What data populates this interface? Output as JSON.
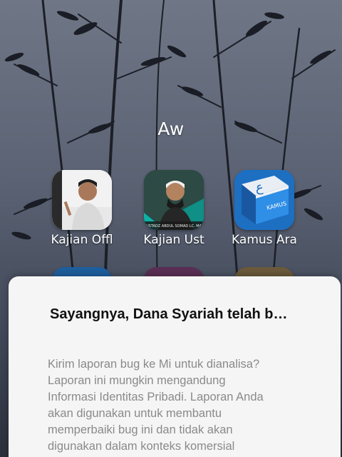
{
  "folder": {
    "title": "Aw",
    "apps": [
      {
        "label": "Kajian Offl",
        "icon": "ustadz-portrait-icon"
      },
      {
        "label": "Kajian Ust",
        "icon": "ustadz-video-icon"
      },
      {
        "label": "Kamus Ara",
        "icon": "kamus-book-icon"
      }
    ],
    "icon_banner_text": "USTADZ ABDUL SOMAD LC. MA",
    "kamus_icon_text": "KAMUS",
    "kamus_icon_glyph": "ع"
  },
  "dialog": {
    "title": "Sayangnya, Dana Syariah telah b…",
    "message_lines": [
      "Kirim laporan bug ke Mi untuk dianalisa?",
      "Laporan ini mungkin mengandung",
      "Informasi Identitas Pribadi. Laporan Anda",
      "akan digunakan untuk membantu",
      "memperbaiki bug ini dan tidak akan",
      "digunakan dalam konteks komersial"
    ]
  },
  "colors": {
    "dialog_bg": "#f5f5f5",
    "title_text": "#111111",
    "message_text": "#8a8a8a",
    "kamus_blue": "#1f7fd6"
  }
}
